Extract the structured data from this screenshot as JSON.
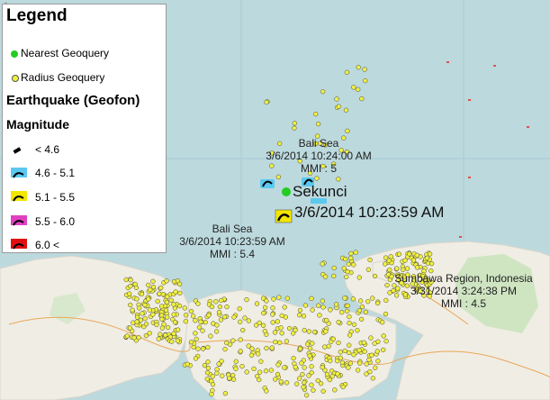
{
  "legend": {
    "title": "Legend",
    "nearest_label": "Nearest Geoquery",
    "radius_label": "Radius Geoquery",
    "layer_title": "Earthquake (Geofon)",
    "magnitude_title": "Magnitude",
    "classes": [
      {
        "label": "< 4.6",
        "color": "#ffffff"
      },
      {
        "label": "4.6 - 5.1",
        "color": "#5bc8f0"
      },
      {
        "label": "5.1 - 5.5",
        "color": "#f2e600"
      },
      {
        "label": "5.5 - 6.0",
        "color": "#e040c0"
      },
      {
        "label": "6.0 <",
        "color": "#e01010"
      }
    ],
    "nearest_color": "#22cc22",
    "radius_color": "#f0f040"
  },
  "labels": {
    "quake1": {
      "line1": "Bali Sea",
      "line2": "3/6/2014 10:24:00 AM",
      "line3": "MMI : 5"
    },
    "quake2": {
      "line1": "Bali Sea",
      "line2": "3/6/2014 10:23:59 AM",
      "line3": "MMI : 5.4"
    },
    "quake3": {
      "line1": "Sumbawa Region, Indonesia",
      "line2": "3/31/2014 3:24:38 PM",
      "line3": "MMI : 4.5"
    },
    "nearest_name": "Sekunci",
    "nearest_time": "3/6/2014 10:23:59 AM"
  },
  "colors": {
    "sea": "#bcd9dd",
    "land": "#f0ede4",
    "park": "#cfe5c2",
    "grid": "#9fc3d4"
  }
}
